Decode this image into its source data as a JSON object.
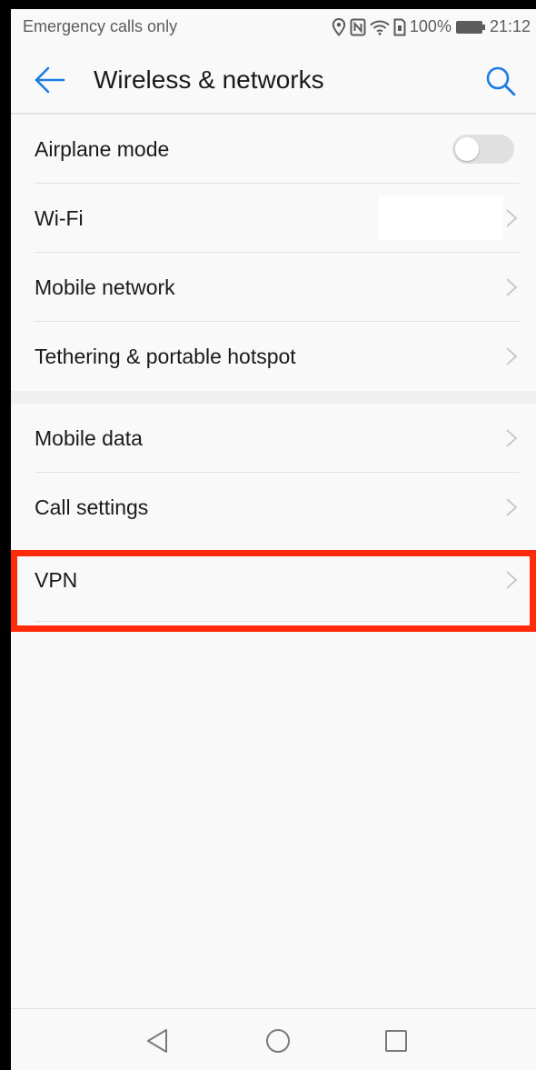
{
  "status_bar": {
    "carrier_text": "Emergency calls only",
    "battery_percent": "100%",
    "time": "21:12",
    "icons": [
      "location-icon",
      "nfc-icon",
      "wifi-signal-icon",
      "sim-icon",
      "battery-icon"
    ]
  },
  "header": {
    "title": "Wireless & networks",
    "back_icon": "back-arrow-icon",
    "search_icon": "search-icon"
  },
  "group1": [
    {
      "label": "Airplane mode",
      "control": "toggle",
      "toggle_on": false
    },
    {
      "label": "Wi-Fi",
      "control": "chevron",
      "value": ""
    },
    {
      "label": "Mobile network",
      "control": "chevron"
    },
    {
      "label": "Tethering & portable hotspot",
      "control": "chevron"
    }
  ],
  "group2": [
    {
      "label": "Mobile data",
      "control": "chevron"
    },
    {
      "label": "Call settings",
      "control": "chevron"
    },
    {
      "label": "VPN",
      "control": "chevron",
      "highlighted": true
    }
  ],
  "nav_bar": {
    "buttons": [
      "nav-back-icon",
      "nav-home-icon",
      "nav-recent-apps-icon"
    ]
  },
  "colors": {
    "accent": "#1a7ce3",
    "highlight": "#ff2a0a",
    "background": "#f9f9f9",
    "text": "#1a1a1a"
  }
}
